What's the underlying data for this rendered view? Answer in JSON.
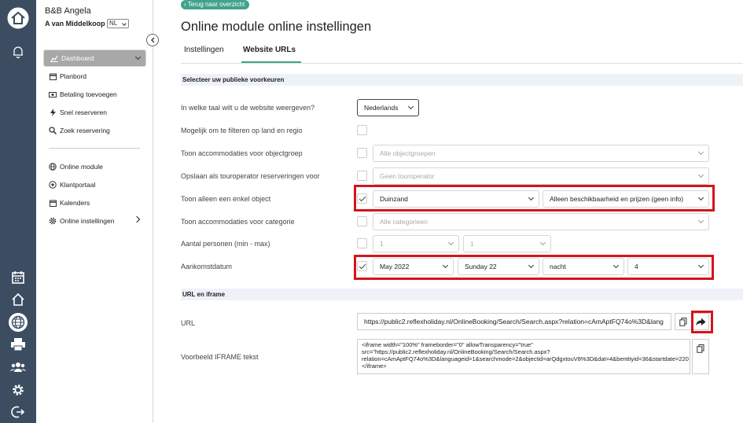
{
  "rail": {
    "icons": [
      "home-icon",
      "bell-icon",
      "calendar-icon",
      "house-icon",
      "globe-icon",
      "print-icon",
      "users-icon",
      "gear-icon",
      "logout-icon"
    ]
  },
  "sidebar": {
    "org": "B&B Angela",
    "user": "A van Middelkoop",
    "lang": "NL",
    "items": [
      {
        "label": "Dashboard",
        "icon": "chart-icon"
      },
      {
        "label": "Planbord",
        "icon": "calendar-icon"
      },
      {
        "label": "Betaling toevoegen",
        "icon": "money-icon"
      },
      {
        "label": "Snel reserveren",
        "icon": "bolt-icon"
      },
      {
        "label": "Zoek reservering",
        "icon": "search-icon"
      },
      {
        "label": "Online module",
        "icon": "globe-icon"
      },
      {
        "label": "Klantportaal",
        "icon": "portal-icon"
      },
      {
        "label": "Kalenders",
        "icon": "calendar-icon"
      },
      {
        "label": "Online instellingen",
        "icon": "gear-icon"
      }
    ]
  },
  "header": {
    "back": "Terug naar overzicht",
    "title": "Online module online instellingen"
  },
  "tabs": [
    {
      "label": "Instellingen"
    },
    {
      "label": "Website URLs"
    }
  ],
  "sections": {
    "prefs": "Selecteer uw publieke voorkeuren",
    "url": "URL en iframe"
  },
  "rows": {
    "lang": {
      "label": "In welke taal wilt u de website weergeven?",
      "value": "Nederlands"
    },
    "filter": {
      "label": "Mogelijk om te filteren op land en regio"
    },
    "group": {
      "label": "Toon accommodaties voor objectgroep",
      "value": "Alle objectgroepen"
    },
    "touroperator": {
      "label": "Opslaan als touroperator reserveringen voor",
      "value": "Geen touroperator"
    },
    "single": {
      "label": "Toon alleen een enkel object",
      "value": "Duinzand",
      "mode": "Alleen beschikbaarheid en prijzen (geen info)"
    },
    "category": {
      "label": "Toon accommodaties voor categorie",
      "value": "Alle categorieen"
    },
    "persons": {
      "label": "Aantal personen (min - max)",
      "min": "1",
      "max": "1"
    },
    "arrival": {
      "label": "Aankomstdatum",
      "month": "May 2022",
      "day": "Sunday 22",
      "unit": "nacht",
      "count": "4"
    }
  },
  "url": {
    "label": "URL",
    "value": "https://public2.reflexholiday.nl/OnlineBooking/Search/Search.aspx?relation=cAmAptFQ74o%3D&lang"
  },
  "iframe": {
    "label": "Voorbeeld IFRAME tekst",
    "line1": "<iframe width=\"100%\" frameborder=\"0\" allowTransparency=\"true\"",
    "line2": "src=\"https://public2.reflexholiday.nl/OnlineBooking/Search/Search.aspx?",
    "line3": "relation=cAmAptFQ74o%3D&languageid=1&searchmode=2&objectid=arQdgxtouV8%3D&dat=4&bentityid=36&startdate=220",
    "line4": "</iframe>"
  },
  "colors": {
    "rail": "#3c4d61",
    "accent": "#41a38c",
    "highlight": "#d4141c"
  }
}
